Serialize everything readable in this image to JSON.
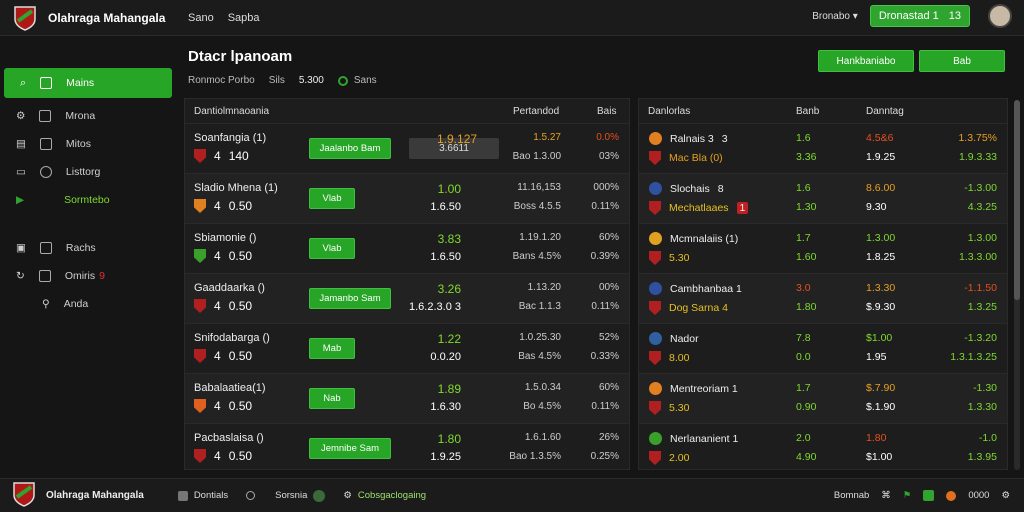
{
  "app": {
    "title": "Olahraga Mahangala"
  },
  "topnav": [
    "Sano",
    "Sapba"
  ],
  "top_right": {
    "dropdown": "Bronabo",
    "balance_label": "Dronastad 1",
    "balance_value": "13"
  },
  "sidebar": {
    "items": [
      {
        "label": "Mains",
        "icon": "search-icon",
        "active": true
      },
      {
        "label": "Mrona",
        "icon": "gear-icon"
      },
      {
        "label": "Mitos",
        "icon": "book-icon"
      },
      {
        "label": "Listtorg",
        "icon": "list-icon"
      },
      {
        "label": "Sormtebo",
        "icon": "play-icon"
      },
      {
        "label": "Rachs",
        "icon": "chat-icon"
      },
      {
        "label": "Omiris",
        "badge": "9",
        "icon": "refresh-icon"
      },
      {
        "label": "Anda",
        "icon": "person-icon"
      }
    ]
  },
  "header": {
    "title": "Dtacr lpanoam",
    "sub1": "Ronmoc Porbo",
    "sub2": "Sils",
    "sub3": "5.300",
    "live": "Sans",
    "btn1": "Hankbaniabo",
    "btn2": "Bab"
  },
  "left_panel": {
    "headers": [
      "Dantiolmnaoania",
      "Pertandod",
      "Bais"
    ],
    "rows": [
      {
        "name": "Soanfangia (1)",
        "num": "4",
        "score": "140",
        "btn": "Jaalanbo Bam",
        "gray": "3.6611",
        "c1": "1.9.127",
        "c1b": "",
        "c2": "1.5.27",
        "c2b": "Bao 1.3.00",
        "c3": "0.0%",
        "c3b": "03%",
        "c1_color": "#e5a020",
        "c2_color": "#e5a020",
        "c3_color": "#e55020",
        "crest": "#b02020"
      },
      {
        "name": "Sladio Mhena (1)",
        "num": "4",
        "score": "0.50",
        "btn": "Vlab",
        "c1": "1.00",
        "c1b": "1.6.50",
        "c2": "11.16,153",
        "c2b": "Boss 4.5.5",
        "c3": "000%",
        "c3b": "0.11%",
        "crest": "#e08020"
      },
      {
        "name": "Sbiamonie ()",
        "num": "4",
        "score": "0.50",
        "btn": "Vlab",
        "c1": "3.83",
        "c1b": "1.6.50",
        "c2": "1.19.1.20",
        "c2b": "Bans 4.5%",
        "c3": "60%",
        "c3b": "0.39%",
        "crest": "#3aa02a"
      },
      {
        "name": "Gaaddaarka ()",
        "num": "4",
        "score": "0.50",
        "btn": "Jamanbo Sam",
        "c1": "3.26",
        "c1b": "1.6.2.3.0 3",
        "c2": "1.13.20",
        "c2b": "Bac 1.1.3",
        "c3": "00%",
        "c3b": "0.11%",
        "crest": "#b02020"
      },
      {
        "name": "Snifodabarga ()",
        "num": "4",
        "score": "0.50",
        "btn": "Mab",
        "c1": "1.22",
        "c1b": "0.0.20",
        "c2": "1.0.25.30",
        "c2b": "Bas 4.5%",
        "c3": "52%",
        "c3b": "0.33%",
        "crest": "#b02020"
      },
      {
        "name": "Babalaatiea(1)",
        "num": "4",
        "score": "0.50",
        "btn": "Nab",
        "c1": "1.89",
        "c1b": "1.6.30",
        "c2": "1.5.0.34",
        "c2b": "Bo 4.5%",
        "c3": "60%",
        "c3b": "0.11%",
        "crest": "#e06020"
      },
      {
        "name": "Pacbaslaisa ()",
        "num": "4",
        "score": "0.50",
        "btn": "Jemnibe Sam",
        "c1": "1.80",
        "c1b": "1.9.25",
        "c2": "1.6.1.60",
        "c2b": "Bao 1.3.5%",
        "c3": "26%",
        "c3b": "0.25%",
        "crest": "#b02020"
      }
    ]
  },
  "right_panel": {
    "headers": [
      "Danlorlas",
      "Banb",
      "Danntag"
    ],
    "rows": [
      {
        "l1": "Ralnais 3",
        "l1n": "3",
        "l2": "Mac Bla (0)",
        "a1": "1.6",
        "a2": "3.36",
        "b1": "4.5&6",
        "b2": "1.9.25",
        "c1": "1.3.75%",
        "c2": "1.9.3.33",
        "a1c": "#7fd92f",
        "b1c": "#e55020",
        "c1c": "#e5a020",
        "l2c": "#e5a020"
      },
      {
        "l1": "Slochais",
        "l1n": "8",
        "l2": "Mechatlaaes",
        "l2n": "1",
        "a1": "1.6",
        "a2": "1.30",
        "b1": "8.6.00",
        "b2": "9.30",
        "c1": "-1.3.00",
        "c2": "4.3.25",
        "a1c": "#7fd92f",
        "b1c": "#e5a020"
      },
      {
        "l1": "Mcmnalaiis (1)",
        "l2": "5.30",
        "a1": "1.7",
        "a2": "1.60",
        "b1": "1.3.00",
        "b2": "1.8.25",
        "c1": "1.3.00",
        "c2": "1.3.3.00"
      },
      {
        "l1": "Cambhanbaa 1",
        "l2": "Dog Sarna 4",
        "a1": "3.0",
        "a2": "1.80",
        "b1": "1.3.30",
        "b2": "$.9.30",
        "c1": "-1.1.50",
        "c2": "1.3.25",
        "a1c": "#e55020",
        "b1c": "#e5a020",
        "c1c": "#e55020"
      },
      {
        "l1": "Nador",
        "l2": "8.00",
        "a1": "7.8",
        "a2": "0.0",
        "b1": "$1.00",
        "b2": "1.95",
        "c1": "-1.3.20",
        "c2": "1.3.1.3.25"
      },
      {
        "l1": "Mentreoriam 1",
        "l2": "5.30",
        "a1": "1.7",
        "a2": "0.90",
        "b1": "$.7.90",
        "b2": "$.1.90",
        "c1": "-1.30",
        "c2": "1.3.30",
        "b1c": "#e5a020"
      },
      {
        "l1": "Nerlananient 1",
        "l2": "2.00",
        "a1": "2.0",
        "a2": "4.90",
        "b1": "1.80",
        "b2": "$1.00",
        "c1": "-1.0",
        "c2": "1.3.95",
        "b1c": "#e55020"
      }
    ]
  },
  "footer": {
    "items": [
      "Dontials",
      "Sorsnia",
      "Cobsgaclogaing"
    ],
    "right": [
      "Bomnab",
      "0000"
    ]
  }
}
